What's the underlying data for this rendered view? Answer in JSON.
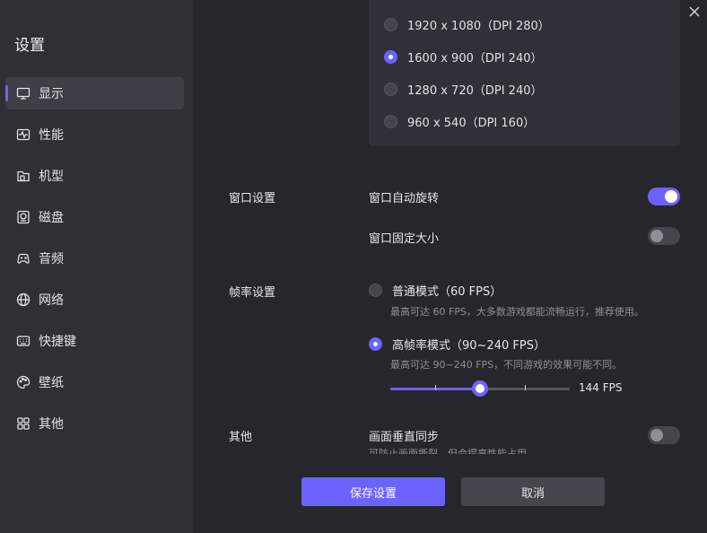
{
  "sidebar": {
    "title": "设置",
    "items": [
      {
        "label": "显示",
        "icon": "monitor-icon",
        "active": true
      },
      {
        "label": "性能",
        "icon": "performance-icon"
      },
      {
        "label": "机型",
        "icon": "device-model-icon"
      },
      {
        "label": "磁盘",
        "icon": "disk-icon"
      },
      {
        "label": "音频",
        "icon": "audio-icon"
      },
      {
        "label": "网络",
        "icon": "network-icon"
      },
      {
        "label": "快捷键",
        "icon": "keyboard-icon"
      },
      {
        "label": "壁纸",
        "icon": "palette-icon"
      },
      {
        "label": "其他",
        "icon": "grid-icon"
      }
    ]
  },
  "resolution": {
    "options": [
      {
        "label": "1920 x 1080（DPI 280）",
        "checked": false
      },
      {
        "label": "1600 x 900（DPI 240）",
        "checked": true
      },
      {
        "label": "1280 x 720（DPI 240）",
        "checked": false
      },
      {
        "label": "960 x 540（DPI 160）",
        "checked": false
      }
    ]
  },
  "window": {
    "section_label": "窗口设置",
    "auto_rotate_label": "窗口自动旋转",
    "auto_rotate_on": true,
    "fixed_size_label": "窗口固定大小",
    "fixed_size_on": false
  },
  "framerate": {
    "section_label": "帧率设置",
    "normal_label": "普通模式（60 FPS）",
    "normal_desc": "最高可达 60 FPS，大多数游戏都能流畅运行，推荐使用。",
    "normal_checked": false,
    "high_label": "高帧率模式（90~240 FPS）",
    "high_desc": "最高可达 90~240 FPS，不同游戏的效果可能不同。",
    "high_checked": true,
    "slider_min": 90,
    "slider_max": 240,
    "slider_value": 144,
    "slider_value_label": "144 FPS"
  },
  "other": {
    "section_label": "其他",
    "vsync_label": "画面垂直同步",
    "vsync_desc": "可防止画面撕裂，但会提高性能占用",
    "vsync_on": false
  },
  "footer": {
    "save_label": "保存设置",
    "cancel_label": "取消"
  },
  "colors": {
    "accent": "#6c63ff",
    "sidebar_bg": "#2f3036",
    "main_bg": "#26272c"
  }
}
